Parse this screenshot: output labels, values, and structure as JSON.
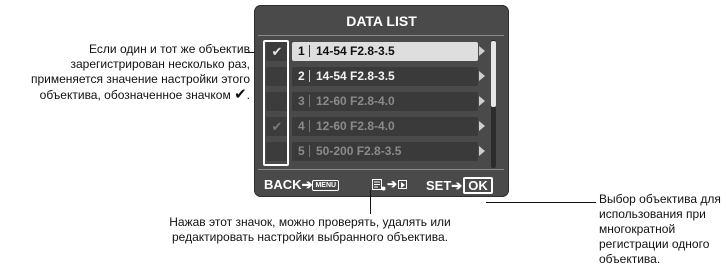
{
  "screen": {
    "title": "DATA LIST",
    "rows": [
      {
        "num": "1",
        "lens": "14-54 F2.8-3.5",
        "checked": true,
        "state": "selected"
      },
      {
        "num": "2",
        "lens": "14-54 F2.8-3.5",
        "checked": false,
        "state": "normal"
      },
      {
        "num": "3",
        "lens": "12-60 F2.8-4.0",
        "checked": false,
        "state": "dim"
      },
      {
        "num": "4",
        "lens": "12-60 F2.8-4.0",
        "checked": true,
        "state": "dim"
      },
      {
        "num": "5",
        "lens": "50-200 F2.8-3.5",
        "checked": false,
        "state": "dim"
      }
    ],
    "footer": {
      "back_label": "BACK",
      "arrow": "➔",
      "menu_key": "MENU",
      "set_label": "SET",
      "ok_label": "OK"
    }
  },
  "callouts": {
    "left": "Если один и тот же объектив зарегистрирован несколько раз, применяется значение настройки этого объектива, обозначенное значком",
    "left_end": ".",
    "right": "Выбор объектива для использования при многократной регистрации одного объектива.",
    "bottom_line1": "Нажав этот значок, можно проверять, удалять или",
    "bottom_line2": "редактировать настройки выбранного объектива."
  },
  "icons": [
    "checkmark-icon",
    "arrow-right-icon",
    "menu-key-icon",
    "info-icon",
    "ok-key-icon"
  ]
}
